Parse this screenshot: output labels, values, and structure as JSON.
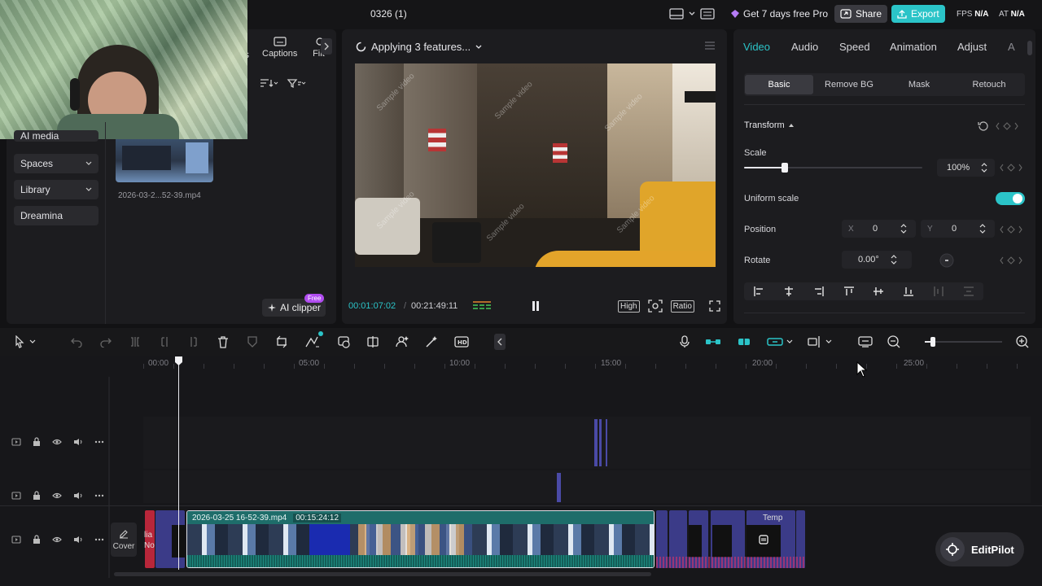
{
  "topbar": {
    "project_title": "0326 (1)",
    "pro_promo": "Get 7 days free Pro",
    "share_label": "Share",
    "export_label": "Export",
    "fps_label": "FPS",
    "fps_value": "N/A",
    "cat_label": "AT",
    "cat_value": "N/A"
  },
  "media_panel": {
    "tabs": [
      {
        "label": "s"
      },
      {
        "label": "Captions"
      },
      {
        "label": "Filt"
      }
    ],
    "sidebar": [
      {
        "label": "AI media"
      },
      {
        "label": "Spaces"
      },
      {
        "label": "Library"
      },
      {
        "label": "Dreamina"
      }
    ],
    "media_item_name": "2026-03-2...52-39.mp4",
    "ai_clipper_label": "AI clipper",
    "free_badge": "Free"
  },
  "preview": {
    "status": "Applying 3 features...",
    "current_time": "00:01:07:02",
    "separator": "/",
    "total_time": "00:21:49:11",
    "quality_label": "High",
    "ratio_label": "Ratio",
    "watermark": "Sample video"
  },
  "properties": {
    "tabs": [
      {
        "label": "Video",
        "active": true
      },
      {
        "label": "Audio"
      },
      {
        "label": "Speed"
      },
      {
        "label": "Animation"
      },
      {
        "label": "Adjust"
      },
      {
        "label": "A"
      }
    ],
    "subtabs": [
      {
        "label": "Basic",
        "active": true
      },
      {
        "label": "Remove BG"
      },
      {
        "label": "Mask"
      },
      {
        "label": "Retouch"
      }
    ],
    "transform_label": "Transform",
    "scale_label": "Scale",
    "scale_value": "100%",
    "scale_fraction": 0.23,
    "uniform_scale_label": "Uniform scale",
    "uniform_scale_on": true,
    "position_label": "Position",
    "pos_x_label": "X",
    "pos_x_value": "0",
    "pos_y_label": "Y",
    "pos_y_value": "0",
    "rotate_label": "Rotate",
    "rotate_value": "0.00°"
  },
  "timeline": {
    "ruler": [
      "00:00",
      "05:00",
      "10:00",
      "15:00",
      "20:00",
      "25:00"
    ],
    "cover_label": "Cover",
    "main_clip_name": "2026-03-25 16-52-39.mp4",
    "main_clip_duration": "00:15:24:12",
    "clip_fragment_1": "lia",
    "clip_fragment_2": "No",
    "temp_clip_label": "Temp",
    "zoom_fraction": 0.1
  },
  "editpilot_label": "EditPilot",
  "colors": {
    "accent": "#2bc4c8",
    "panel": "#1c1c1f",
    "clip": "#1d5e5c",
    "track_blue": "#4a4aa6"
  }
}
